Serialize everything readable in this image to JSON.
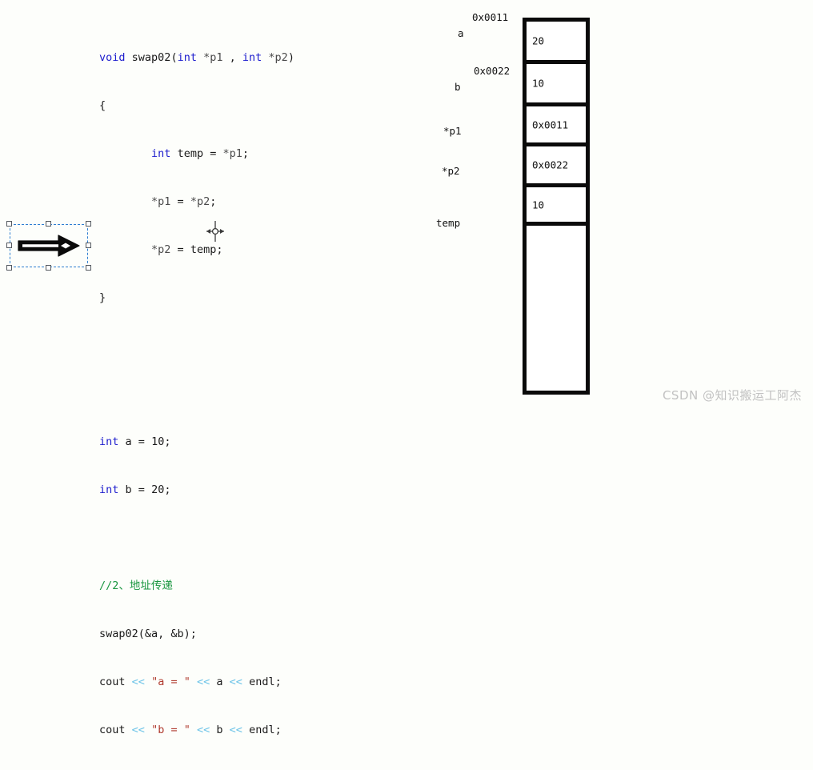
{
  "background_color": "#fdfefb",
  "code": {
    "font": "monospace",
    "colors": {
      "keyword": "#1c1ccd",
      "string": "#b03a2e",
      "operator": "#6ec4e8",
      "comment": "#1a9640",
      "plain": "#1a1a1a"
    },
    "lines": [
      {
        "id": "l1",
        "text": "void swap02(int *p1 , int *p2)"
      },
      {
        "id": "l2",
        "text": "{"
      },
      {
        "id": "l3",
        "text": "        int temp = *p1;"
      },
      {
        "id": "l4",
        "text": "        *p1 = *p2;"
      },
      {
        "id": "l5",
        "text": "        *p2 = temp;"
      },
      {
        "id": "l6",
        "text": "}"
      },
      {
        "id": "l7",
        "text": ""
      },
      {
        "id": "l8",
        "text": ""
      },
      {
        "id": "l9",
        "text": "int a = 10;"
      },
      {
        "id": "l10",
        "text": "int b = 20;"
      },
      {
        "id": "l11",
        "text": ""
      },
      {
        "id": "l12",
        "text": "//2、地址传递"
      },
      {
        "id": "l13",
        "text": "swap02(&a, &b);"
      },
      {
        "id": "l14",
        "text": "cout << \"a = \" << a << endl;"
      },
      {
        "id": "l15",
        "text": "cout << \"b = \" << b << endl;"
      }
    ],
    "tokens": {
      "kw_void": "void",
      "kw_int": "int",
      "fn_swap02": "swap02",
      "param_p1": "*p1",
      "param_p2": "*p2",
      "var_temp": "temp",
      "var_a": "a",
      "var_b": "b",
      "val_10": "10",
      "val_20": "20",
      "comment_2": "//2、地址传递",
      "call_swap02": "swap02(&a, &b);",
      "cout": "cout",
      "shift": "<<",
      "endl": "endl",
      "str_a": "\"a = \"",
      "str_b": "\"b = \"",
      "brace_open": "{",
      "brace_close": "}",
      "semicolon": ";",
      "paren_open": "(",
      "paren_close": ")",
      "comma": ",",
      "equals": "="
    }
  },
  "memory_diagram": {
    "label": "memory-column",
    "border_color": "#0a0a0a",
    "cells": [
      {
        "id": "cell-a",
        "value": "20",
        "label": "a",
        "address": "0x0011"
      },
      {
        "id": "cell-b",
        "value": "10",
        "label": "b",
        "address": "0x0022"
      },
      {
        "id": "cell-p1",
        "value": "0x0011",
        "label": "*p1",
        "address": ""
      },
      {
        "id": "cell-p2",
        "value": "0x0022",
        "label": "*p2",
        "address": ""
      },
      {
        "id": "cell-temp",
        "value": "10",
        "label": "temp",
        "address": ""
      },
      {
        "id": "cell-empty",
        "value": "",
        "label": "",
        "address": ""
      }
    ]
  },
  "shape": {
    "name": "right-block-arrow",
    "selected": true,
    "selection_color": "#2f7fd1",
    "handle_count": 8,
    "fill": "#0a0a0a"
  },
  "cursor": {
    "name": "move-crosshair-cursor"
  },
  "watermark": {
    "text": "CSDN @知识搬运工阿杰",
    "color": "#c2c2c2"
  }
}
